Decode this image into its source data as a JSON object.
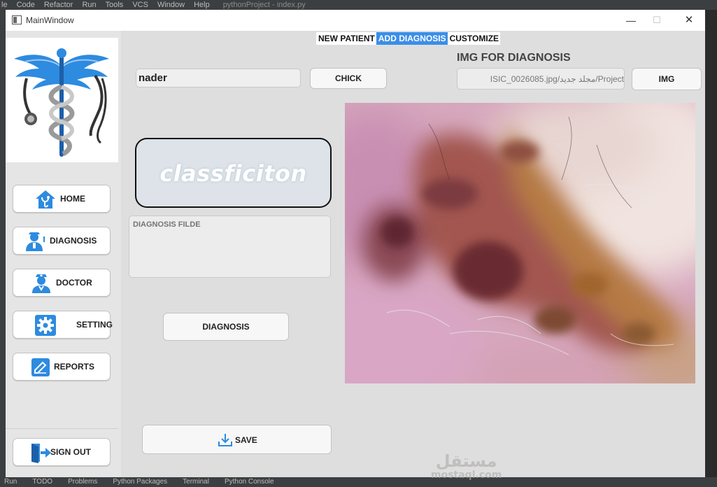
{
  "ide": {
    "menu": [
      "le",
      "Code",
      "Refactor",
      "Run",
      "Tools",
      "VCS",
      "Window",
      "Help"
    ],
    "file_title": "pythonProject - index.py",
    "bottom_tabs": [
      "Run",
      "TODO",
      "Problems",
      "Python Packages",
      "Terminal",
      "Python Console"
    ]
  },
  "window": {
    "title": "MainWindow",
    "minimize_symbol": "—",
    "maximize_symbol": "☐",
    "close_symbol": "✕"
  },
  "sidebar": {
    "logo_icon": "caduceus-stethoscope-icon",
    "items": [
      {
        "label": "HOME",
        "icon": "home-stethoscope-icon"
      },
      {
        "label": "DIAGNOSIS",
        "icon": "doctor-icon"
      },
      {
        "label": "DOCTOR",
        "icon": "doctor-icon"
      },
      {
        "label": "SETTING",
        "icon": "gear-icon"
      },
      {
        "label": "REPORTS",
        "icon": "edit-icon"
      }
    ],
    "sign_out": {
      "label": "SIGN OUT",
      "icon": "sign-out-icon"
    }
  },
  "tabs": [
    {
      "label": "NEW PATIENT",
      "active": false
    },
    {
      "label": "ADD DIAGNOSIS",
      "active": true
    },
    {
      "label": "CUSTOMIZE",
      "active": false
    }
  ],
  "main": {
    "patient_name": "nader",
    "check_label": "CHICK",
    "image_heading": "IMG FOR DIAGNOSIS",
    "image_path": "Project/مجلد جديد/ISIC_0026085.jpg",
    "img_button_label": "IMG",
    "classification_text": "classficiton",
    "diagnosis_placeholder": "DIAGNOSIS FILDE",
    "diagnosis_button_label": "DIAGNOSIS",
    "save_label": "SAVE",
    "save_icon": "download-icon"
  },
  "watermark": {
    "arabic": "مستقل",
    "latin": "mostaql.com"
  },
  "colors": {
    "accent": "#3b8ee8",
    "icon_blue": "#2d8be0",
    "button_border": "#c3c3c3"
  }
}
